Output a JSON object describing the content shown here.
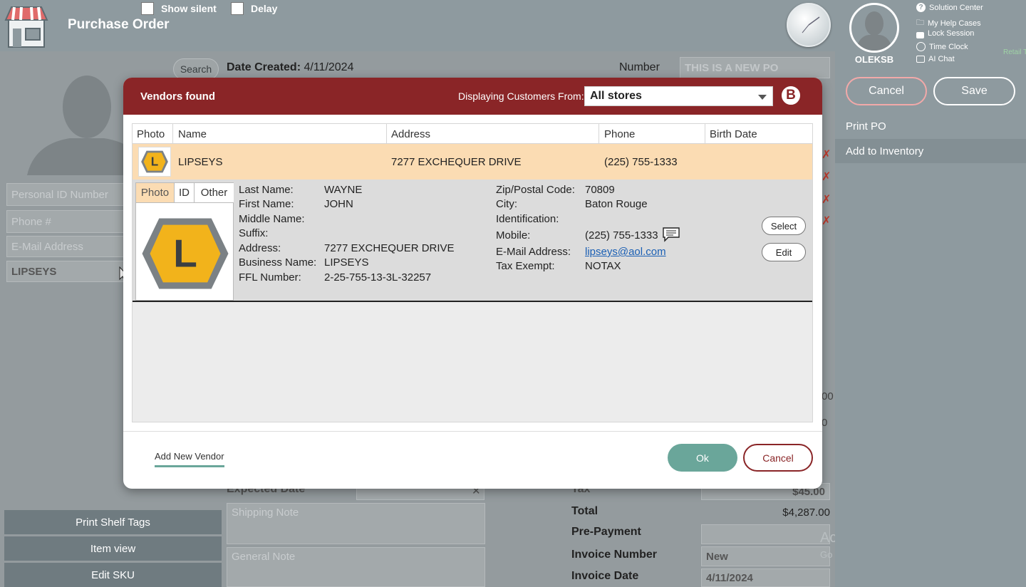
{
  "header": {
    "title": "Purchase Order",
    "show_silent_label": "Show silent",
    "delay_label": "Delay"
  },
  "user": {
    "name": "OLEKSB",
    "links": [
      "Solution Center",
      "My Help Cases",
      "Lock Session",
      "Time Clock",
      "AI Chat"
    ],
    "faint_text": "Retail Tas"
  },
  "actions": {
    "cancel": "Cancel",
    "save": "Save",
    "print_po": "Print PO",
    "add_to_inventory": "Add to Inventory"
  },
  "po": {
    "search": "Search",
    "date_created_label": "Date Created:",
    "date_created": "4/11/2024",
    "number_label": "Number",
    "number_value": "THIS IS A NEW PO",
    "personal_id_placeholder": "Personal ID Number",
    "phone_placeholder": "Phone #",
    "email_placeholder": "E-Mail Address",
    "vendor_value": "LIPSEYS",
    "expected_date_label": "Expected Date",
    "shipping_note_placeholder": "Shipping Note",
    "general_note_placeholder": "General Note",
    "tax_label": "Tax",
    "tax_value": "$45.00",
    "total_label": "Total",
    "total_value": "$4,287.00",
    "prepayment_label": "Pre-Payment",
    "invoice_number_label": "Invoice Number",
    "invoice_number_value": "New",
    "invoice_date_label": "Invoice Date",
    "invoice_date_value": "4/11/2024",
    "side_fragment_a": "Ac",
    "side_fragment_go": "Go",
    "side_fragment_00": "00",
    "side_fragment_0": "0"
  },
  "left_buttons": {
    "print_shelf_tags": "Print Shelf Tags",
    "item_view": "Item view",
    "edit_sku": "Edit SKU"
  },
  "dialog": {
    "title": "Vendors found",
    "displaying_label": "Displaying Customers From:",
    "store_selected": "All stores",
    "brand_letter": "B",
    "columns": [
      "Photo",
      "Name",
      "Address",
      "Phone",
      "Birth Date"
    ],
    "row": {
      "name": "LIPSEYS",
      "address": "7277 EXCHEQUER DRIVE",
      "phone": "(225) 755-1333",
      "logo_letter": "L"
    },
    "tabs": [
      "Photo",
      "ID",
      "Other"
    ],
    "details_left": [
      {
        "label": "Last Name:",
        "value": "WAYNE"
      },
      {
        "label": "First Name:",
        "value": "JOHN"
      },
      {
        "label": "Middle Name:",
        "value": ""
      },
      {
        "label": "Suffix:",
        "value": ""
      },
      {
        "label": "Address:",
        "value": "7277 EXCHEQUER DRIVE"
      },
      {
        "label": "Business Name:",
        "value": "LIPSEYS"
      },
      {
        "label": "FFL Number:",
        "value": "2-25-755-13-3L-32257"
      }
    ],
    "details_right": [
      {
        "label": "Zip/Postal Code:",
        "value": "70809"
      },
      {
        "label": "City:",
        "value": "Baton Rouge"
      },
      {
        "label": "Identification:",
        "value": ""
      },
      {
        "label": "Mobile:",
        "value": "(225) 755-1333"
      },
      {
        "label": "E-Mail Address:",
        "value": "lipseys@aol.com"
      },
      {
        "label": "Tax Exempt:",
        "value": "NOTAX"
      }
    ],
    "select": "Select",
    "edit": "Edit",
    "add_new_vendor": "Add New Vendor",
    "ok": "Ok",
    "cancel": "Cancel"
  },
  "colors": {
    "dialog_header": "#8a2527",
    "selected_row": "#fbdcb3",
    "ok_button": "#6aa69a",
    "link": "#1a5fb4"
  }
}
